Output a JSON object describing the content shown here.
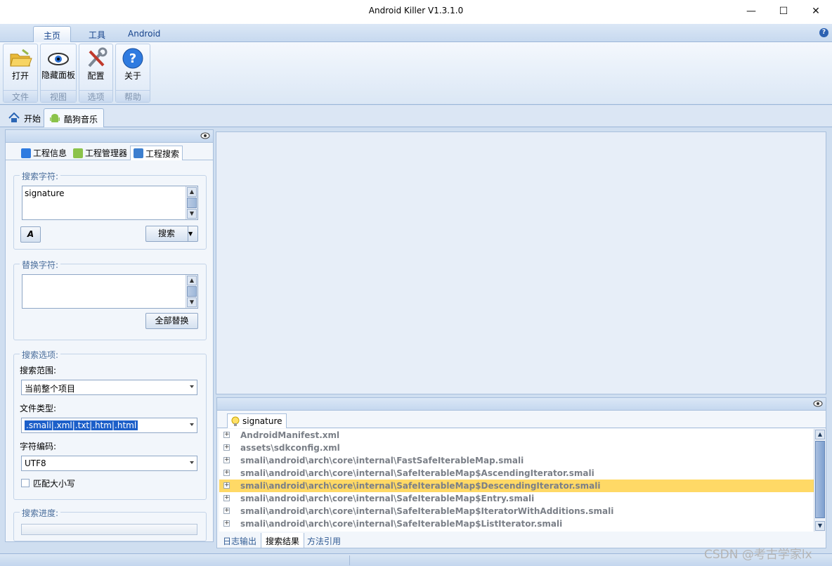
{
  "window": {
    "title": "Android Killer V1.3.1.0",
    "min_glyph": "—",
    "max_glyph": "☐",
    "close_glyph": "✕"
  },
  "ribbon": {
    "tabs": [
      "主页",
      "工具",
      "Android"
    ],
    "active_tab": "主页",
    "help_glyph": "?",
    "groups": [
      {
        "button": "打开",
        "group": "文件",
        "icon": "open-folder-icon"
      },
      {
        "button": "隐藏面板",
        "group": "视图",
        "icon": "eye-icon"
      },
      {
        "button": "配置",
        "group": "选项",
        "icon": "tools-icon"
      },
      {
        "button": "关于",
        "group": "帮助",
        "icon": "help-icon"
      }
    ]
  },
  "doc_tabs": {
    "home": "开始",
    "project": "酷狗音乐"
  },
  "left_panel": {
    "tabs": [
      "工程信息",
      "工程管理器",
      "工程搜索"
    ],
    "active_tab": "工程搜索",
    "search": {
      "legend": "搜索字符:",
      "value": "signature",
      "search_button": "搜索",
      "font_button": "A"
    },
    "replace": {
      "legend": "替换字符:",
      "value": "",
      "replace_all_button": "全部替换"
    },
    "options": {
      "legend": "搜索选项:",
      "scope_label": "搜索范围:",
      "scope_value": "当前整个项目",
      "filetype_label": "文件类型:",
      "filetype_value": ".smali|.xml|.txt|.htm|.html",
      "encoding_label": "字符编码:",
      "encoding_value": "UTF8",
      "match_case_label": "匹配大小写",
      "match_case_checked": false
    },
    "progress": {
      "legend": "搜索进度:",
      "value": 0
    }
  },
  "results": {
    "tab_label": "signature",
    "items": [
      "AndroidManifest.xml",
      "assets\\sdkconfig.xml",
      "smali\\android\\arch\\core\\internal\\FastSafeIterableMap.smali",
      "smali\\android\\arch\\core\\internal\\SafeIterableMap$AscendingIterator.smali",
      "smali\\android\\arch\\core\\internal\\SafeIterableMap$DescendingIterator.smali",
      "smali\\android\\arch\\core\\internal\\SafeIterableMap$Entry.smali",
      "smali\\android\\arch\\core\\internal\\SafeIterableMap$IteratorWithAdditions.smali",
      "smali\\android\\arch\\core\\internal\\SafeIterableMap$ListIterator.smali"
    ],
    "highlighted_index": 4,
    "bottom_tabs": [
      "日志输出",
      "搜索结果",
      "方法引用"
    ],
    "active_bottom_tab": "搜索结果"
  },
  "watermark": "CSDN @考古学家lx",
  "colors": {
    "accent": "#15428b",
    "highlight_row": "#ffd966",
    "selection": "#1c5fc9"
  }
}
